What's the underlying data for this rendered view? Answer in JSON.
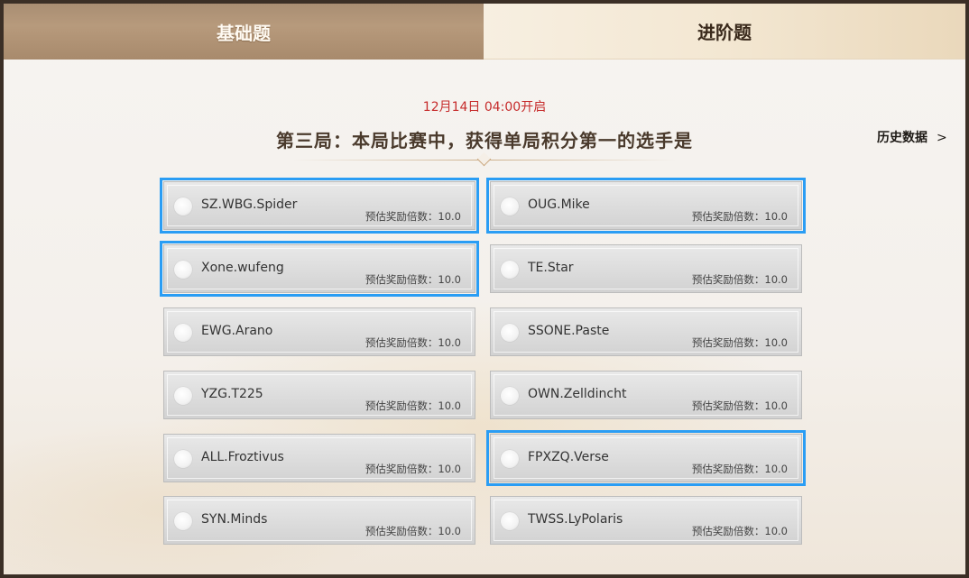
{
  "tabs": {
    "basic": "基础题",
    "advanced": "进阶题"
  },
  "open_time": "12月14日 04:00开启",
  "question": "第三局：本局比赛中，获得单局积分第一的选手是",
  "history_link": {
    "label": "历史数据",
    "chevron": ">"
  },
  "options": [
    {
      "name": "SZ.WBG.Spider",
      "odds": "预估奖励倍数：10.0",
      "selected": true
    },
    {
      "name": "OUG.Mike",
      "odds": "预估奖励倍数：10.0",
      "selected": true
    },
    {
      "name": "Xone.wufeng",
      "odds": "预估奖励倍数：10.0",
      "selected": true
    },
    {
      "name": "TE.Star",
      "odds": "预估奖励倍数：10.0",
      "selected": false
    },
    {
      "name": "EWG.Arano",
      "odds": "预估奖励倍数：10.0",
      "selected": false
    },
    {
      "name": "SSONE.Paste",
      "odds": "预估奖励倍数：10.0",
      "selected": false
    },
    {
      "name": "YZG.T225",
      "odds": "预估奖励倍数：10.0",
      "selected": false
    },
    {
      "name": "OWN.Zelldincht",
      "odds": "预估奖励倍数：10.0",
      "selected": false
    },
    {
      "name": "ALL.Froztivus",
      "odds": "预估奖励倍数：10.0",
      "selected": false
    },
    {
      "name": "FPXZQ.Verse",
      "odds": "预估奖励倍数：10.0",
      "selected": true
    },
    {
      "name": "SYN.Minds",
      "odds": "预估奖励倍数：10.0",
      "selected": false
    },
    {
      "name": "TWSS.LyPolaris",
      "odds": "预估奖励倍数：10.0",
      "selected": false
    }
  ]
}
